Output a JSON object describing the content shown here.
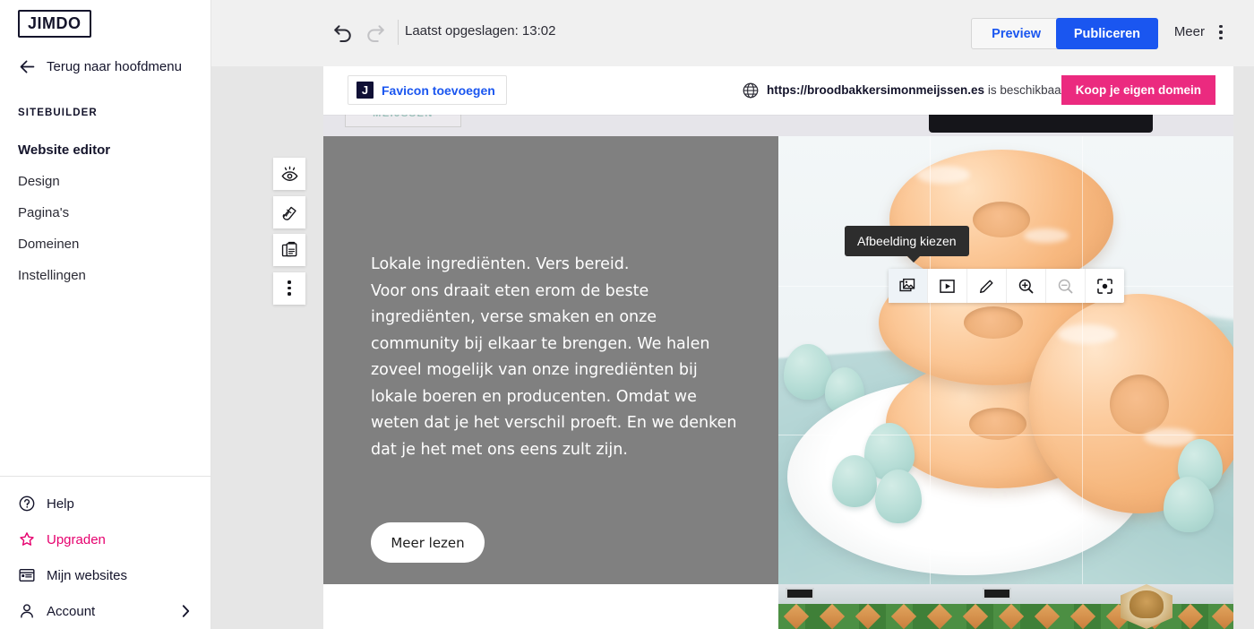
{
  "sidebar": {
    "logo": "JIMDO",
    "back_label": "Terug naar hoofdmenu",
    "back_icon": "arrow-left-icon",
    "section_label": "SITEBUILDER",
    "items": [
      {
        "label": "Website editor",
        "active": true
      },
      {
        "label": "Design",
        "active": false
      },
      {
        "label": "Pagina's",
        "active": false
      },
      {
        "label": "Domeinen",
        "active": false
      },
      {
        "label": "Instellingen",
        "active": false
      }
    ],
    "bottom_items": [
      {
        "label": "Help",
        "icon": "question-circle-icon",
        "accent": false,
        "chevron": false
      },
      {
        "label": "Upgraden",
        "icon": "star-icon",
        "accent": true,
        "chevron": false
      },
      {
        "label": "Mijn websites",
        "icon": "browser-window-icon",
        "accent": false,
        "chevron": false
      },
      {
        "label": "Account",
        "icon": "person-icon",
        "accent": false,
        "chevron": true
      }
    ]
  },
  "topbar": {
    "undo_icon": "undo-arrow-icon",
    "redo_icon": "redo-arrow-icon",
    "saved_text": "Laatst opgeslagen: 13:02",
    "preview_label": "Preview",
    "publish_label": "Publiceren",
    "more_label": "Meer",
    "kebab_icon": "kebab-menu-icon"
  },
  "notification": {
    "favicon_badge": "J",
    "favicon_label": "Favicon toevoegen",
    "globe_icon": "globe-icon",
    "domain_name": "https://broodbakkersimonmeijssen.es",
    "domain_suffix": " is beschikbaar!",
    "buy_label": "Koop je eigen domein"
  },
  "block_tools": [
    {
      "icon": "eye-hide-icon",
      "name": "hide-block"
    },
    {
      "icon": "color-palette-icon",
      "name": "block-style"
    },
    {
      "icon": "duplicate-icon",
      "name": "duplicate-block"
    },
    {
      "icon": "kebab-menu-icon",
      "name": "block-more-options"
    }
  ],
  "image_toolbar": {
    "tooltip": "Afbeelding kiezen",
    "buttons": [
      {
        "icon": "image-picker-icon",
        "name": "choose-image",
        "state": "selected"
      },
      {
        "icon": "video-icon",
        "name": "add-video",
        "state": "enabled"
      },
      {
        "icon": "pencil-icon",
        "name": "edit-image",
        "state": "enabled"
      },
      {
        "icon": "zoom-in-icon",
        "name": "zoom-in",
        "state": "enabled"
      },
      {
        "icon": "zoom-out-icon",
        "name": "zoom-out",
        "state": "disabled"
      },
      {
        "icon": "focus-point-icon",
        "name": "set-focus-point",
        "state": "enabled"
      }
    ]
  },
  "canvas": {
    "site_logo": "MEIJSSEN",
    "section": {
      "heading_line": "Lokale ingrediënten. Vers bereid.",
      "body": "Voor ons draait eten erom de beste ingrediënten, verse smaken en onze community bij elkaar te brengen. We halen zoveel mogelijk van onze ingrediënten bij lokale boeren en producenten. Omdat we weten dat je het verschil proeft. En we denken dat je het met ons eens zult zijn.",
      "cta_label": "Meer lezen",
      "image_alt": "donuts-photo"
    }
  },
  "colors": {
    "brand_blue": "#1a56f0",
    "accent_pink": "#e6006e",
    "domain_pink": "#eb2a7f",
    "panel_gray": "#808080",
    "dark_navy": "#14142b"
  }
}
